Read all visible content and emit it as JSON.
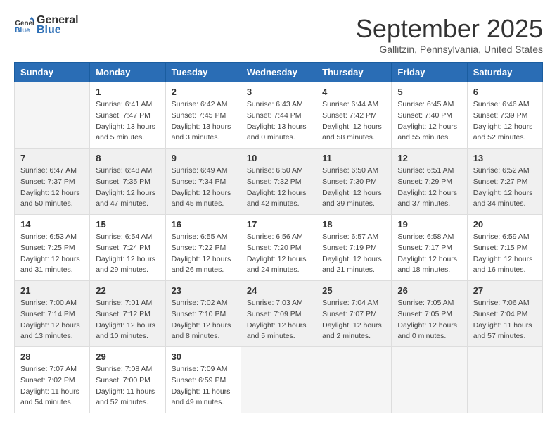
{
  "logo": {
    "text_general": "General",
    "text_blue": "Blue"
  },
  "title": "September 2025",
  "subtitle": "Gallitzin, Pennsylvania, United States",
  "days_of_week": [
    "Sunday",
    "Monday",
    "Tuesday",
    "Wednesday",
    "Thursday",
    "Friday",
    "Saturday"
  ],
  "weeks": [
    [
      {
        "day": "",
        "info": ""
      },
      {
        "day": "1",
        "info": "Sunrise: 6:41 AM\nSunset: 7:47 PM\nDaylight: 13 hours\nand 5 minutes."
      },
      {
        "day": "2",
        "info": "Sunrise: 6:42 AM\nSunset: 7:45 PM\nDaylight: 13 hours\nand 3 minutes."
      },
      {
        "day": "3",
        "info": "Sunrise: 6:43 AM\nSunset: 7:44 PM\nDaylight: 13 hours\nand 0 minutes."
      },
      {
        "day": "4",
        "info": "Sunrise: 6:44 AM\nSunset: 7:42 PM\nDaylight: 12 hours\nand 58 minutes."
      },
      {
        "day": "5",
        "info": "Sunrise: 6:45 AM\nSunset: 7:40 PM\nDaylight: 12 hours\nand 55 minutes."
      },
      {
        "day": "6",
        "info": "Sunrise: 6:46 AM\nSunset: 7:39 PM\nDaylight: 12 hours\nand 52 minutes."
      }
    ],
    [
      {
        "day": "7",
        "info": "Sunrise: 6:47 AM\nSunset: 7:37 PM\nDaylight: 12 hours\nand 50 minutes."
      },
      {
        "day": "8",
        "info": "Sunrise: 6:48 AM\nSunset: 7:35 PM\nDaylight: 12 hours\nand 47 minutes."
      },
      {
        "day": "9",
        "info": "Sunrise: 6:49 AM\nSunset: 7:34 PM\nDaylight: 12 hours\nand 45 minutes."
      },
      {
        "day": "10",
        "info": "Sunrise: 6:50 AM\nSunset: 7:32 PM\nDaylight: 12 hours\nand 42 minutes."
      },
      {
        "day": "11",
        "info": "Sunrise: 6:50 AM\nSunset: 7:30 PM\nDaylight: 12 hours\nand 39 minutes."
      },
      {
        "day": "12",
        "info": "Sunrise: 6:51 AM\nSunset: 7:29 PM\nDaylight: 12 hours\nand 37 minutes."
      },
      {
        "day": "13",
        "info": "Sunrise: 6:52 AM\nSunset: 7:27 PM\nDaylight: 12 hours\nand 34 minutes."
      }
    ],
    [
      {
        "day": "14",
        "info": "Sunrise: 6:53 AM\nSunset: 7:25 PM\nDaylight: 12 hours\nand 31 minutes."
      },
      {
        "day": "15",
        "info": "Sunrise: 6:54 AM\nSunset: 7:24 PM\nDaylight: 12 hours\nand 29 minutes."
      },
      {
        "day": "16",
        "info": "Sunrise: 6:55 AM\nSunset: 7:22 PM\nDaylight: 12 hours\nand 26 minutes."
      },
      {
        "day": "17",
        "info": "Sunrise: 6:56 AM\nSunset: 7:20 PM\nDaylight: 12 hours\nand 24 minutes."
      },
      {
        "day": "18",
        "info": "Sunrise: 6:57 AM\nSunset: 7:19 PM\nDaylight: 12 hours\nand 21 minutes."
      },
      {
        "day": "19",
        "info": "Sunrise: 6:58 AM\nSunset: 7:17 PM\nDaylight: 12 hours\nand 18 minutes."
      },
      {
        "day": "20",
        "info": "Sunrise: 6:59 AM\nSunset: 7:15 PM\nDaylight: 12 hours\nand 16 minutes."
      }
    ],
    [
      {
        "day": "21",
        "info": "Sunrise: 7:00 AM\nSunset: 7:14 PM\nDaylight: 12 hours\nand 13 minutes."
      },
      {
        "day": "22",
        "info": "Sunrise: 7:01 AM\nSunset: 7:12 PM\nDaylight: 12 hours\nand 10 minutes."
      },
      {
        "day": "23",
        "info": "Sunrise: 7:02 AM\nSunset: 7:10 PM\nDaylight: 12 hours\nand 8 minutes."
      },
      {
        "day": "24",
        "info": "Sunrise: 7:03 AM\nSunset: 7:09 PM\nDaylight: 12 hours\nand 5 minutes."
      },
      {
        "day": "25",
        "info": "Sunrise: 7:04 AM\nSunset: 7:07 PM\nDaylight: 12 hours\nand 2 minutes."
      },
      {
        "day": "26",
        "info": "Sunrise: 7:05 AM\nSunset: 7:05 PM\nDaylight: 12 hours\nand 0 minutes."
      },
      {
        "day": "27",
        "info": "Sunrise: 7:06 AM\nSunset: 7:04 PM\nDaylight: 11 hours\nand 57 minutes."
      }
    ],
    [
      {
        "day": "28",
        "info": "Sunrise: 7:07 AM\nSunset: 7:02 PM\nDaylight: 11 hours\nand 54 minutes."
      },
      {
        "day": "29",
        "info": "Sunrise: 7:08 AM\nSunset: 7:00 PM\nDaylight: 11 hours\nand 52 minutes."
      },
      {
        "day": "30",
        "info": "Sunrise: 7:09 AM\nSunset: 6:59 PM\nDaylight: 11 hours\nand 49 minutes."
      },
      {
        "day": "",
        "info": ""
      },
      {
        "day": "",
        "info": ""
      },
      {
        "day": "",
        "info": ""
      },
      {
        "day": "",
        "info": ""
      }
    ]
  ]
}
